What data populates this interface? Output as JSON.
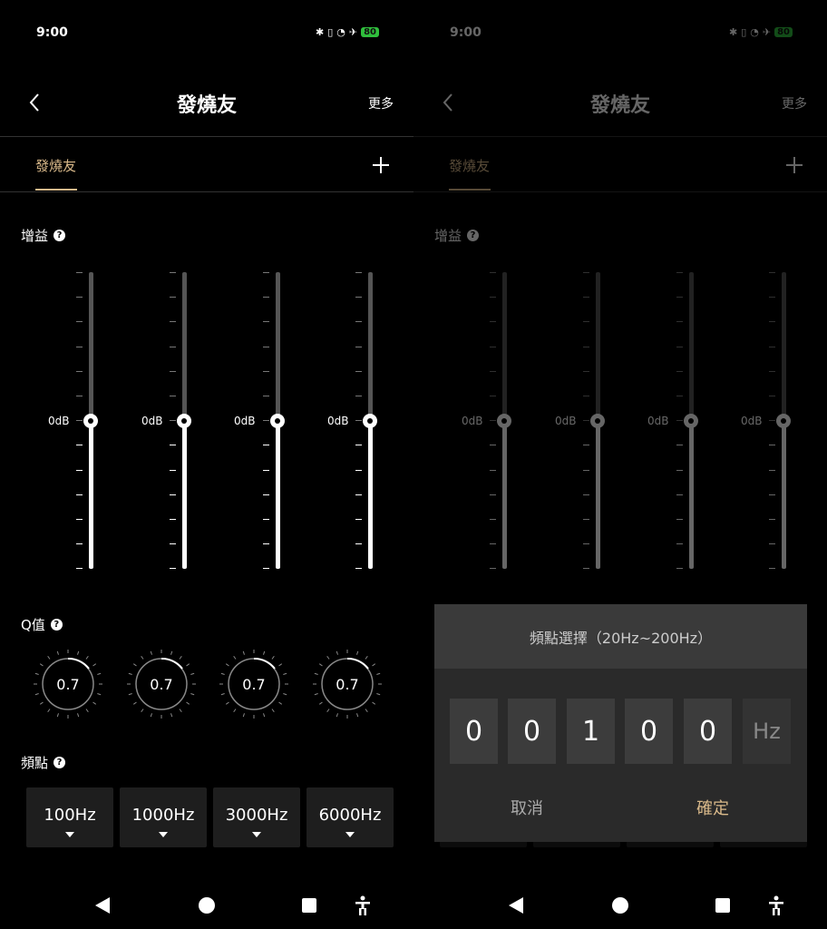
{
  "status": {
    "time": "9:00",
    "battery": "80"
  },
  "header": {
    "title": "發燒友",
    "more_label": "更多"
  },
  "tabs": [
    {
      "label": "發燒友"
    }
  ],
  "gain": {
    "label": "增益",
    "db_label": "0dB"
  },
  "q": {
    "label": "Q值",
    "values": [
      "0.7",
      "0.7",
      "0.7",
      "0.7"
    ]
  },
  "freq": {
    "label": "頻點",
    "values": [
      "100Hz",
      "1000Hz",
      "3000Hz",
      "6000Hz"
    ]
  },
  "dialog": {
    "title": "頻點選擇（20Hz~200Hz）",
    "digits": [
      "0",
      "0",
      "1",
      "0",
      "0"
    ],
    "unit": "Hz",
    "cancel_label": "取消",
    "confirm_label": "確定"
  },
  "colors": {
    "accent": "#d9b98a",
    "background": "#000000"
  }
}
